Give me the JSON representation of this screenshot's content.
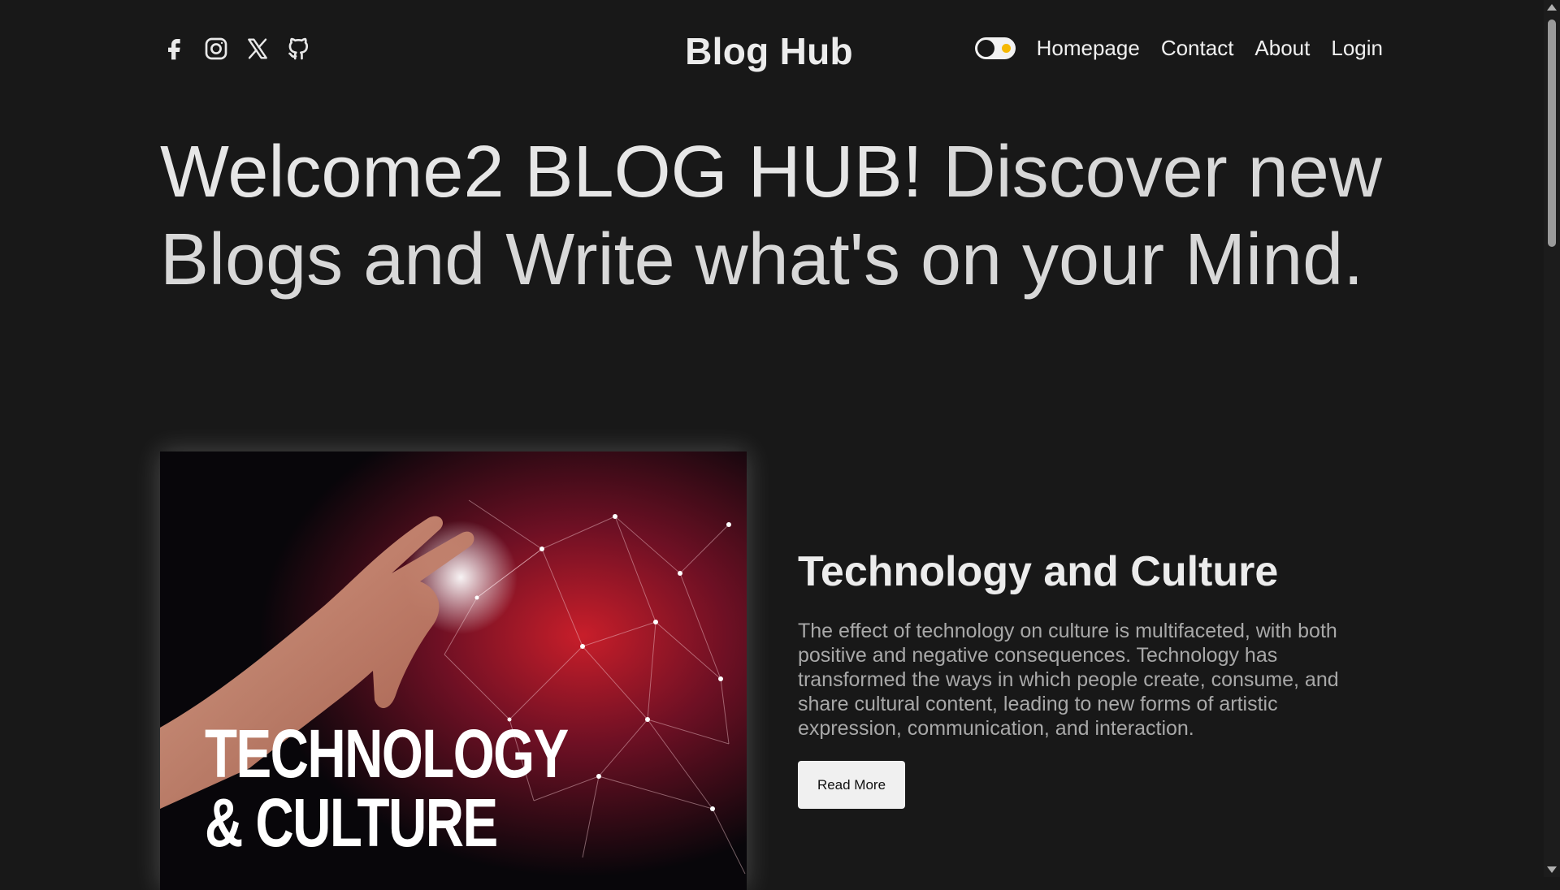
{
  "header": {
    "social_icons": [
      "facebook-icon",
      "instagram-icon",
      "x-twitter-icon",
      "github-icon"
    ],
    "brand": "Blog Hub",
    "theme_toggle": {
      "state": "dark",
      "knob_color": "#181818",
      "indicator_color": "#f5b800"
    },
    "nav": {
      "homepage": "Homepage",
      "contact": "Contact",
      "about": "About",
      "login": "Login"
    }
  },
  "hero": {
    "bold_part": "Welcome2 BLOG HUB!",
    "light_part": "Discover new Blogs and Write what's on your Mind."
  },
  "featured_post": {
    "image_caption_line1": "TECHNOLOGY",
    "image_caption_line2": "& CULTURE",
    "title": "Technology and Culture",
    "excerpt": "The effect of technology on culture is multifaceted, with both positive and negative consequences. Technology has transformed the ways in which people create, consume, and share cultural content, leading to new forms of artistic expression, communication, and interaction.",
    "read_more_label": "Read More"
  },
  "colors": {
    "background": "#181818",
    "text": "#e6e6e6",
    "muted_text": "#a8a8a8",
    "button_bg": "#f0f0f0"
  }
}
